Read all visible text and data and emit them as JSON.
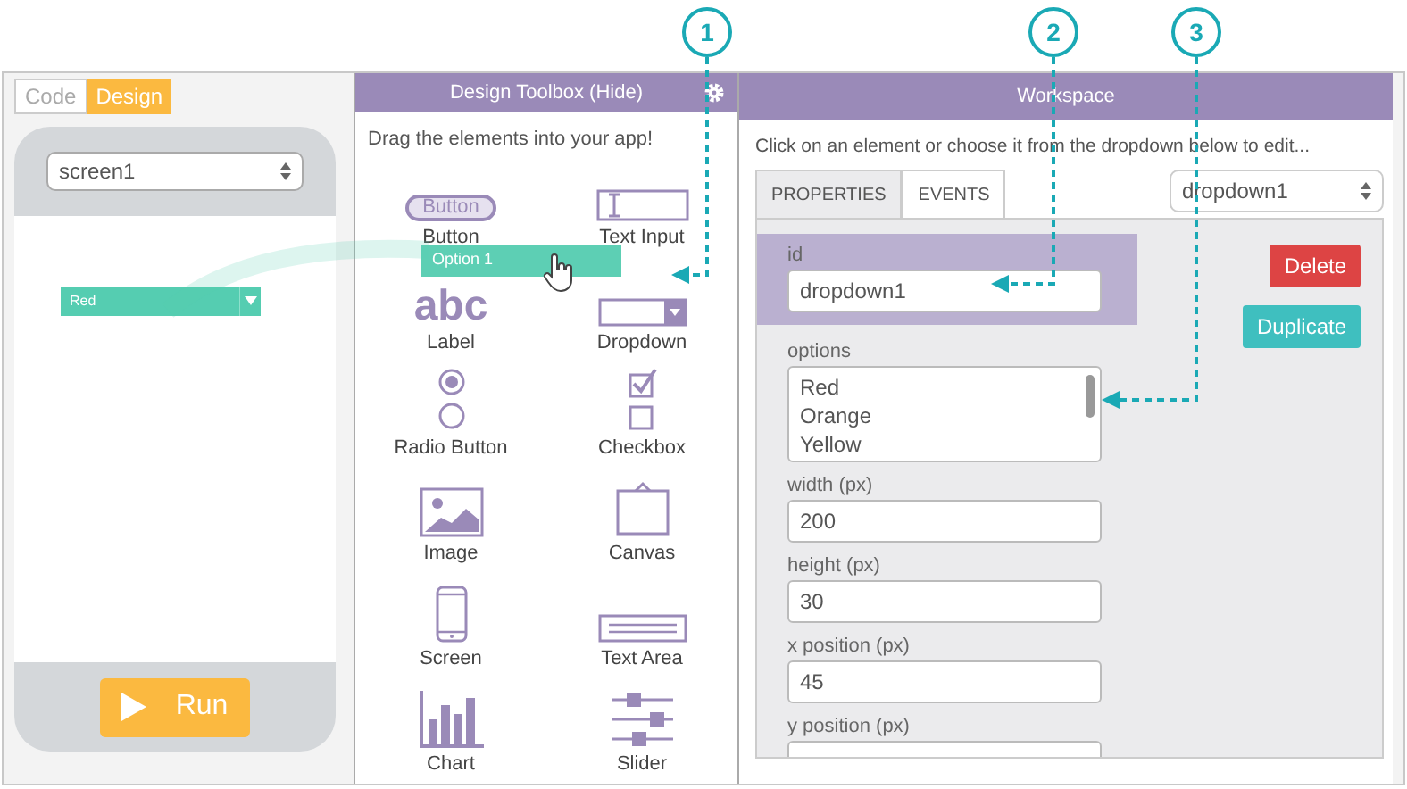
{
  "mode_toggle": [
    {
      "label": "Code",
      "selected": false
    },
    {
      "label": "Design",
      "selected": true
    }
  ],
  "phone": {
    "screen_select": "screen1",
    "widget_value": "Red",
    "run_button": "Run"
  },
  "toolbox": {
    "title": "Design Toolbox (Hide)",
    "hint": "Drag the elements into your app!",
    "items": [
      {
        "kind": "button",
        "label": "Button",
        "icon_text": "Button"
      },
      {
        "kind": "text_input",
        "label": "Text Input"
      },
      {
        "kind": "label",
        "label": "Label",
        "icon_text": "abc"
      },
      {
        "kind": "dropdown",
        "label": "Dropdown"
      },
      {
        "kind": "radio",
        "label": "Radio Button"
      },
      {
        "kind": "checkbox",
        "label": "Checkbox"
      },
      {
        "kind": "image",
        "label": "Image"
      },
      {
        "kind": "canvas",
        "label": "Canvas"
      },
      {
        "kind": "screen",
        "label": "Screen"
      },
      {
        "kind": "text_area",
        "label": "Text Area"
      },
      {
        "kind": "chart",
        "label": "Chart"
      },
      {
        "kind": "slider",
        "label": "Slider"
      }
    ]
  },
  "drag_ghost": {
    "label": "Option 1"
  },
  "workspace": {
    "title": "Workspace",
    "hint": "Click on an element or choose it from the dropdown below to edit...",
    "tabs": [
      {
        "label": "PROPERTIES",
        "selected": true
      },
      {
        "label": "EVENTS",
        "selected": false
      }
    ],
    "element_select": "dropdown1",
    "fields": [
      {
        "kind": "input",
        "label": "id",
        "value": "dropdown1",
        "highlighted": true
      },
      {
        "kind": "textarea",
        "label": "options",
        "lines": [
          "Red",
          "Orange",
          "Yellow"
        ],
        "highlighted": false
      },
      {
        "kind": "input",
        "label": "width (px)",
        "value": "200",
        "highlighted": false
      },
      {
        "kind": "input",
        "label": "height (px)",
        "value": "30",
        "highlighted": false
      },
      {
        "kind": "input",
        "label": "x position (px)",
        "value": "45",
        "highlighted": false
      },
      {
        "kind": "input",
        "label": "y position (px)",
        "highlighted": false
      }
    ],
    "buttons": [
      {
        "kind": "danger",
        "label": "Delete"
      },
      {
        "kind": "secondary",
        "label": "Duplicate"
      }
    ]
  },
  "callouts": [
    {
      "number": "1"
    },
    {
      "number": "2"
    },
    {
      "number": "3"
    }
  ]
}
